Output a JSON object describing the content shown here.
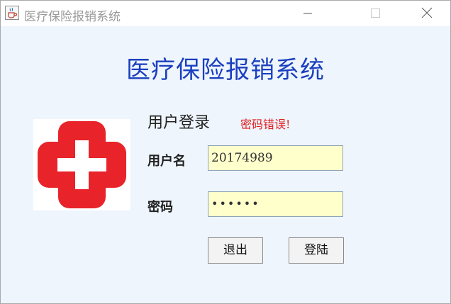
{
  "window": {
    "title": "医疗保险报销系统"
  },
  "main": {
    "heading": "医疗保险报销系统",
    "login_title": "用户登录",
    "error_message": "密码错误!",
    "username_label": "用户名",
    "username_value": "20174989",
    "password_label": "密码",
    "password_masked": "••••••",
    "exit_button": "退出",
    "login_button": "登陆"
  },
  "colors": {
    "background": "#eef5fd",
    "heading": "#1a3fbf",
    "error": "#e02020",
    "input_fill": "#ffffcc",
    "logo_red": "#e8232a"
  },
  "icons": {
    "app": "java-cup-icon",
    "logo": "medical-cross-icon"
  }
}
